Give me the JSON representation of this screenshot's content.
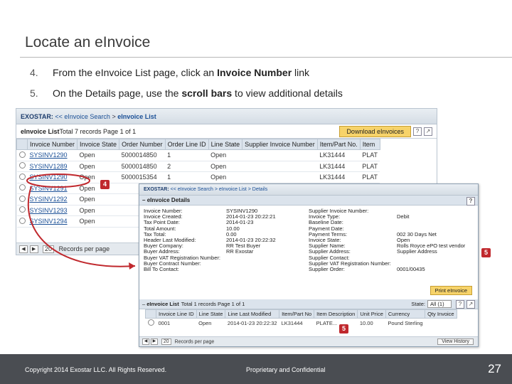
{
  "slide": {
    "title": "Locate an eInvoice",
    "steps": [
      {
        "num": "4.",
        "pre": "From the eInvoice List page, click an ",
        "bold": "Invoice Number",
        "post": " link"
      },
      {
        "num": "5.",
        "pre": "On the Details page, use the ",
        "bold": "scroll bars",
        "post": " to view additional details"
      }
    ]
  },
  "list_screen": {
    "brand": "EXOSTAR:",
    "breadcrumb_back": "<<",
    "breadcrumb_search": "eInvoice Search",
    "breadcrumb_sep": ">",
    "breadcrumb_current": "eInvoice List",
    "list_title": "eInvoice List",
    "list_summary": " Total 7 records Page 1 of 1",
    "download_button": "Download eInvoices",
    "columns": [
      "Invoice Number",
      "Invoice State",
      "Order Number",
      "Order Line ID",
      "Line State",
      "Supplier Invoice Number",
      "Item/Part No.",
      "Item"
    ],
    "rows": [
      [
        "SYSINV1290",
        "Open",
        "5000014850",
        "1",
        "Open",
        "",
        "LK31444",
        "PLAT"
      ],
      [
        "SYSINV1289",
        "Open",
        "5000014850",
        "2",
        "Open",
        "",
        "LK31444",
        "PLAT"
      ],
      [
        "SYSINV1290",
        "Open",
        "5000015354",
        "1",
        "Open",
        "",
        "LK31444",
        "PLAT"
      ],
      [
        "SYSINV1291",
        "Open",
        "",
        "",
        "",
        "",
        "",
        ""
      ],
      [
        "SYSINV1292",
        "Open",
        "",
        "",
        "",
        "",
        "",
        ""
      ],
      [
        "SYSINV1293",
        "Open",
        "",
        "",
        "",
        "",
        "",
        ""
      ],
      [
        "SYSINV1294",
        "Open",
        "",
        "",
        "",
        "",
        "",
        ""
      ]
    ],
    "page_size": "20",
    "page_size_label": "Records per page"
  },
  "detail_screen": {
    "brand": "EXOSTAR:",
    "breadcrumb": "<< eInvoice Search > eInvoice List > Details",
    "panel_title": "eInvoice Details",
    "fields_col1": [
      "Invoice Number:",
      "Invoice Created:",
      "Tax Point Date:",
      "Total Amount:",
      "Tax Total:",
      "Header Last Modified:",
      "Buyer Company:",
      "Buyer Address:",
      "Buyer VAT Registration Number:",
      "Buyer Contract Number:",
      "Bill To Contact:"
    ],
    "fields_col2": [
      "SYSINV1290",
      "2014-01-23 20:22:21",
      "2014-01-23",
      "10.00",
      "0.00",
      "2014-01-23 20:22:32",
      "RR Test Buyer",
      "RR Exostar",
      "",
      "",
      ""
    ],
    "fields_col3": [
      "Supplier Invoice Number:",
      "Invoice Type:",
      "Baseline Date:",
      "Payment Date:",
      "Payment Terms:",
      "Invoice State:",
      "Supplier Name:",
      "Supplier Address:",
      "Supplier Contact:",
      "Supplier VAT Registration Number:",
      "Supplier Order:"
    ],
    "fields_col4": [
      "",
      "Debit",
      "",
      "",
      "002 30 Days Net",
      "Open",
      "Rolls Royce ePO test vendor",
      "Supplier Address",
      "",
      "",
      "0001/00435"
    ],
    "print_button": "Print eInvoice",
    "list_title": "eInvoice List",
    "list_summary": "Total 1 records Page 1 of 1",
    "state_label": "State:",
    "state_value": "All (1)",
    "columns": [
      "Invoice Line ID",
      "Line State",
      "Line Last Modified",
      "Item/Part No",
      "Item Description",
      "Unit Price",
      "Currency",
      "Qty Invoice"
    ],
    "rows": [
      [
        "0001",
        "Open",
        "2014-01-23 20:22:32",
        "LK31444",
        "PLATE...",
        "10.00",
        "Pound Sterling",
        ""
      ]
    ],
    "page_size": "20",
    "page_size_label": "Records per page",
    "view_history_button": "View History"
  },
  "callouts": {
    "c4": "4",
    "c5a": "5",
    "c5b": "5"
  },
  "footer": {
    "copyright": "Copyright 2014 Exostar LLC. All Rights Reserved.",
    "confidential": "Proprietary and Confidential",
    "page_number": "27"
  },
  "colors": {
    "callout": "#c0282d",
    "footer": "#4a4d52",
    "accent": "#f7d36a"
  }
}
